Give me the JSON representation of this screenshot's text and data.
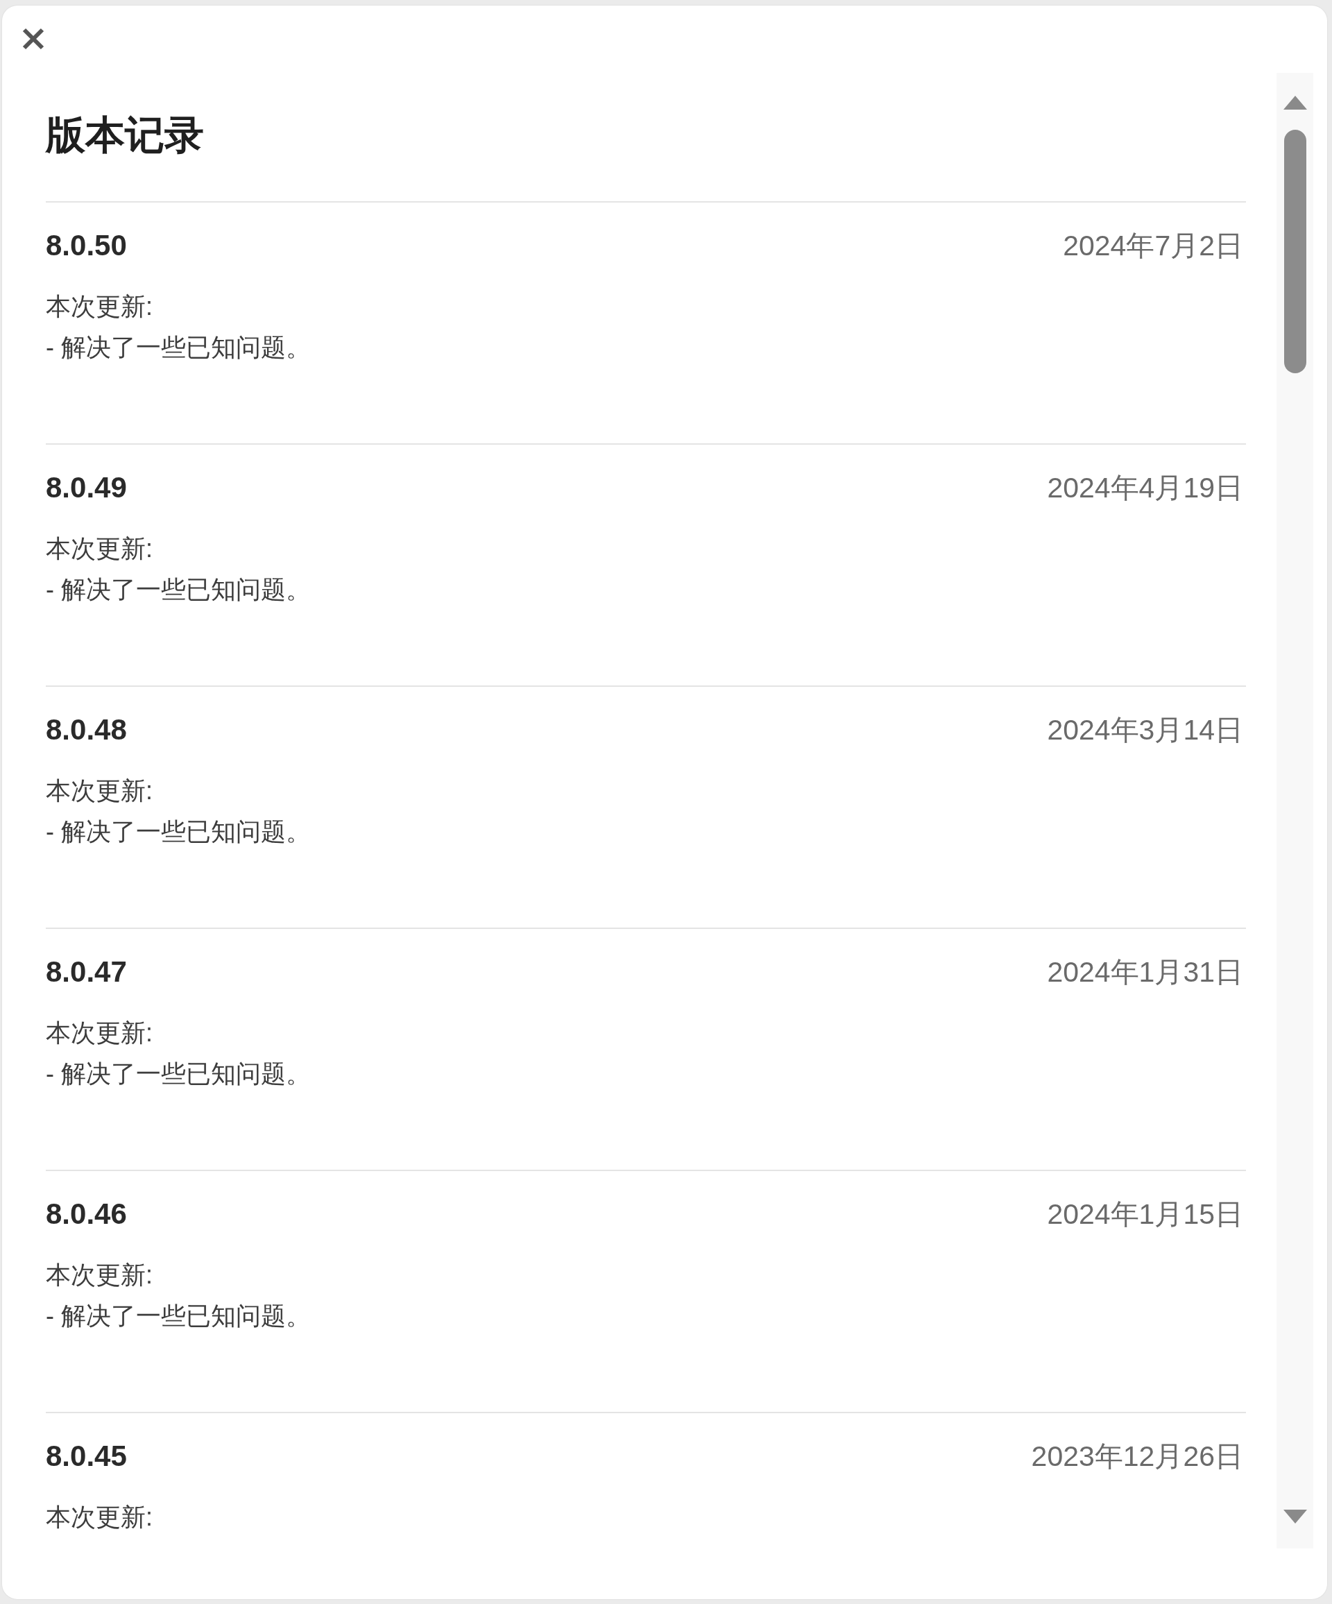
{
  "title": "版本记录",
  "releases": [
    {
      "version": "8.0.50",
      "date": "2024年7月2日",
      "heading": "本次更新:",
      "items": [
        "- 解决了一些已知问题。"
      ]
    },
    {
      "version": "8.0.49",
      "date": "2024年4月19日",
      "heading": "本次更新:",
      "items": [
        "- 解决了一些已知问题。"
      ]
    },
    {
      "version": "8.0.48",
      "date": "2024年3月14日",
      "heading": "本次更新:",
      "items": [
        "- 解决了一些已知问题。"
      ]
    },
    {
      "version": "8.0.47",
      "date": "2024年1月31日",
      "heading": "本次更新:",
      "items": [
        "- 解决了一些已知问题。"
      ]
    },
    {
      "version": "8.0.46",
      "date": "2024年1月15日",
      "heading": "本次更新:",
      "items": [
        "- 解决了一些已知问题。"
      ]
    },
    {
      "version": "8.0.45",
      "date": "2023年12月26日",
      "heading": "本次更新:"
    }
  ]
}
